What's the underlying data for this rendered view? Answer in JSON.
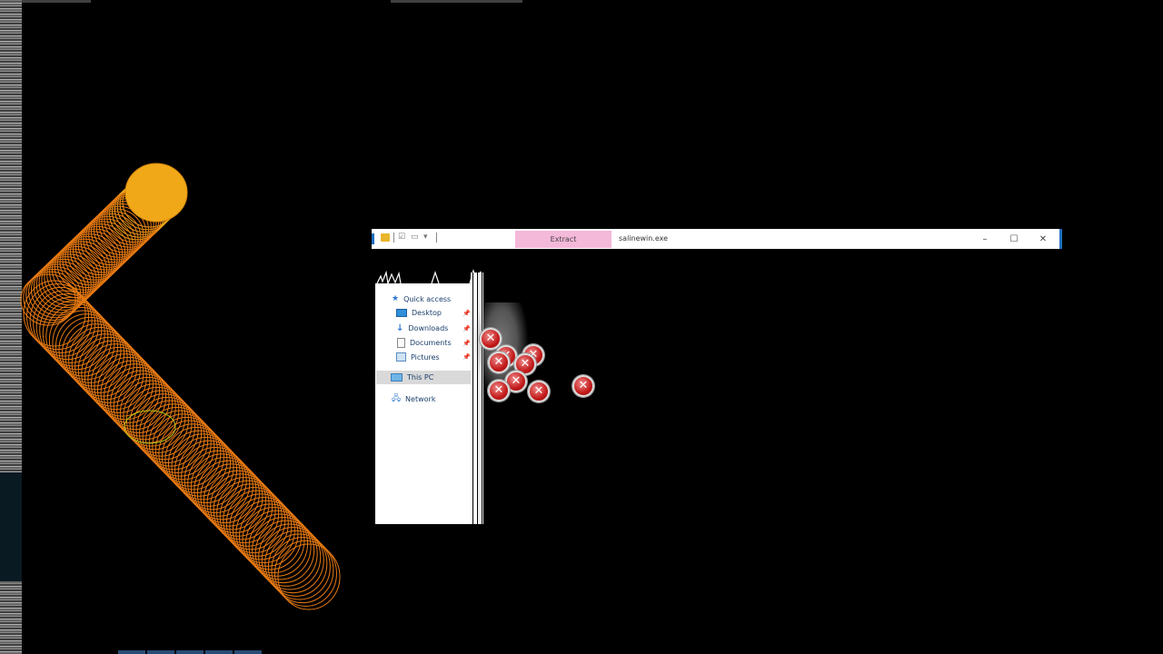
{
  "window": {
    "title": "salinewin.exe",
    "ribbon_tab": "Extract",
    "controls": {
      "minimize": "–",
      "maximize": "☐",
      "close": "✕"
    },
    "accent_color": "#1f6fbf",
    "extract_tab_color": "#f4b8d9"
  },
  "navpane": {
    "items": [
      {
        "label": "Quick access",
        "icon": "star-icon",
        "pinned": false
      },
      {
        "label": "Desktop",
        "icon": "desktop-icon",
        "pinned": true
      },
      {
        "label": "Downloads",
        "icon": "download-icon",
        "pinned": true
      },
      {
        "label": "Documents",
        "icon": "document-icon",
        "pinned": true
      },
      {
        "label": "Pictures",
        "icon": "pictures-icon",
        "pinned": true
      },
      {
        "label": "This PC",
        "icon": "computer-icon",
        "pinned": false,
        "selected": true
      },
      {
        "label": "Network",
        "icon": "network-icon",
        "pinned": false
      }
    ]
  },
  "error_icon": {
    "glyph": "✕",
    "color": "#c31a1a"
  },
  "art": {
    "cylinder_top_color": "#f0a818",
    "cylinder_body_color": "#e87a12"
  }
}
